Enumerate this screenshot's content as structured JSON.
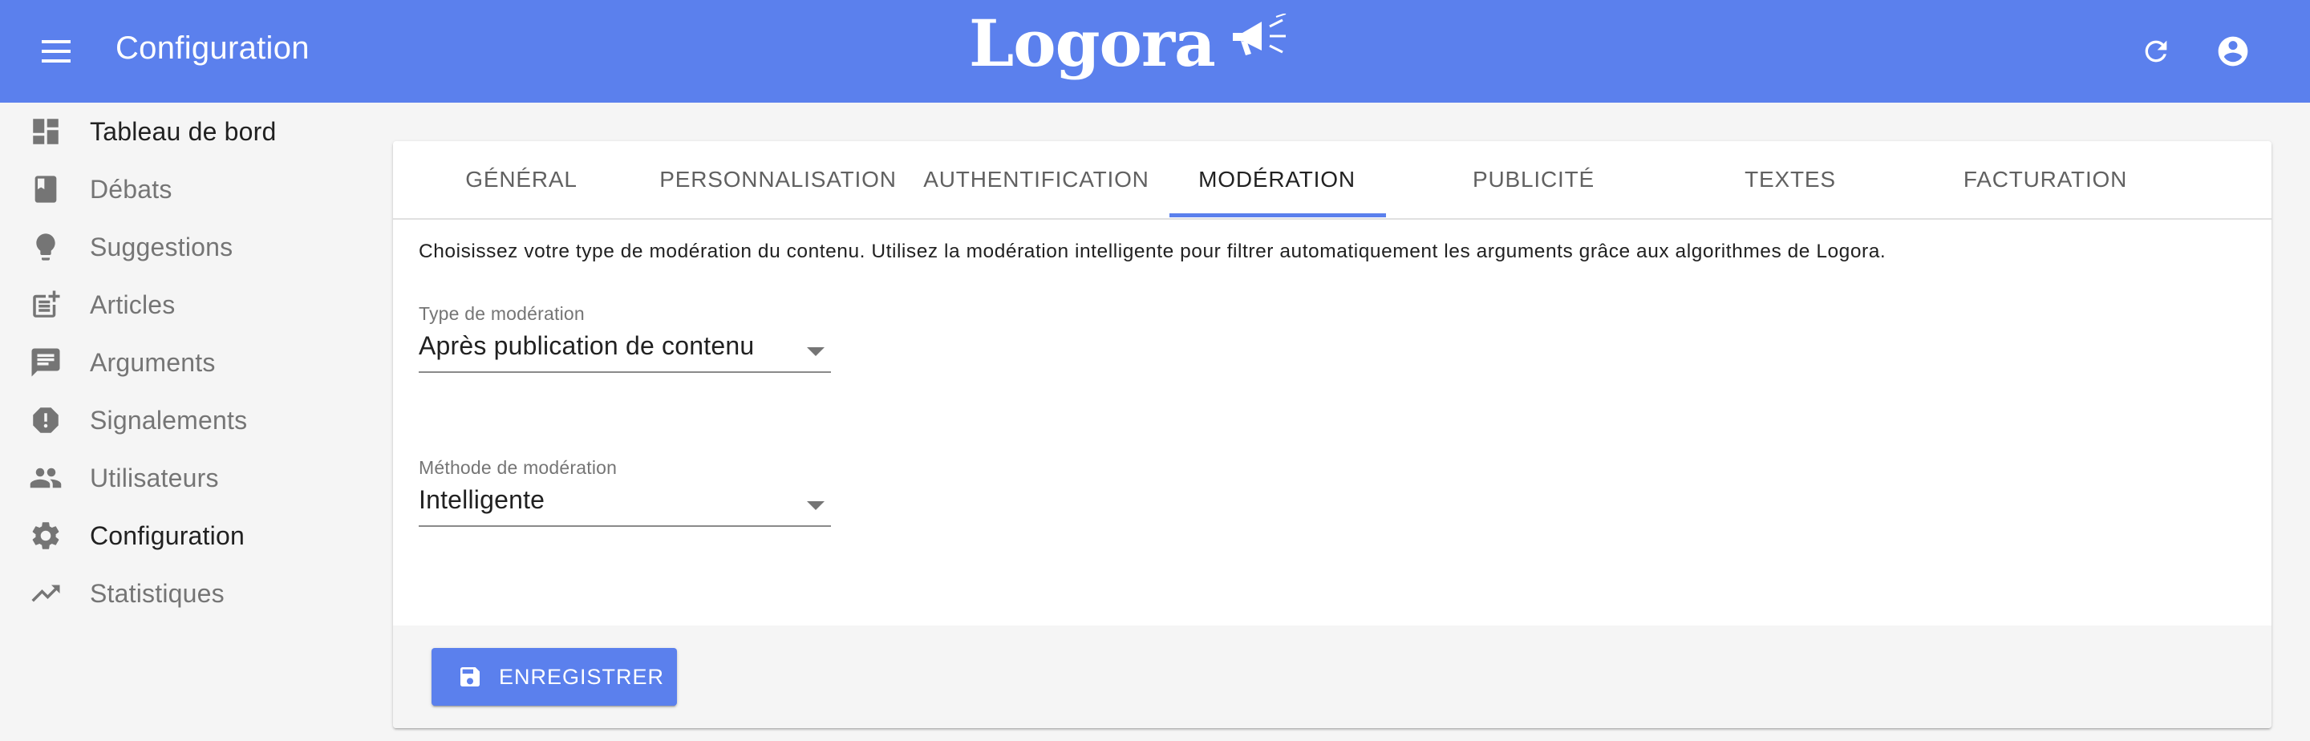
{
  "colors": {
    "primary": "#5b80ed",
    "icon_gray": "#757575"
  },
  "appbar": {
    "title": "Configuration",
    "logo_text": "Logora",
    "menu_icon": "menu-icon",
    "refresh_icon": "refresh-icon",
    "account_icon": "account-circle-icon"
  },
  "sidebar": {
    "items": [
      {
        "label": "Tableau de bord",
        "icon": "dashboard-icon"
      },
      {
        "label": "Débats",
        "icon": "book-icon"
      },
      {
        "label": "Suggestions",
        "icon": "lightbulb-icon"
      },
      {
        "label": "Articles",
        "icon": "post-add-icon"
      },
      {
        "label": "Arguments",
        "icon": "comment-icon"
      },
      {
        "label": "Signalements",
        "icon": "report-icon"
      },
      {
        "label": "Utilisateurs",
        "icon": "people-icon"
      },
      {
        "label": "Configuration",
        "icon": "settings-icon",
        "active": true
      },
      {
        "label": "Statistiques",
        "icon": "trending-up-icon"
      }
    ]
  },
  "tabs": [
    {
      "label": "GÉNÉRAL"
    },
    {
      "label": "PERSONNALISATION"
    },
    {
      "label": "AUTHENTIFICATION"
    },
    {
      "label": "MODÉRATION",
      "active": true
    },
    {
      "label": "PUBLICITÉ"
    },
    {
      "label": "TEXTES"
    },
    {
      "label": "FACTURATION"
    }
  ],
  "moderation": {
    "description": "Choisissez votre type de modération du contenu. Utilisez la modération intelligente pour filtrer automatiquement les arguments grâce aux algorithmes de Logora.",
    "type_label": "Type de modération",
    "type_value": "Après publication de contenu",
    "method_label": "Méthode de modération",
    "method_value": "Intelligente"
  },
  "footer": {
    "save_label": "ENREGISTRER",
    "save_icon": "save-icon"
  }
}
